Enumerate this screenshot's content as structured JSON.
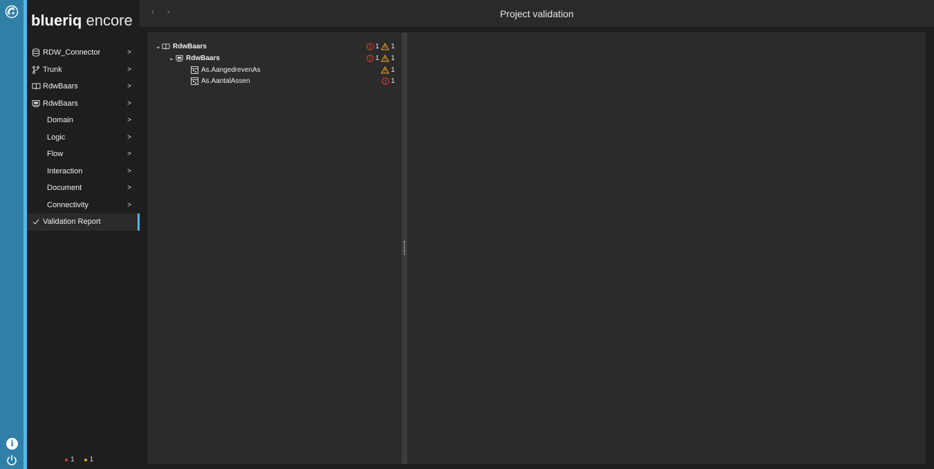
{
  "brand": {
    "name_bold": "blueriq",
    "name_light": "encore"
  },
  "header": {
    "title": "Project validation",
    "back": "‹",
    "forward": "›"
  },
  "sidebar": {
    "items": [
      {
        "label": "RDW_Connector",
        "icon": "database-icon"
      },
      {
        "label": "Trunk",
        "icon": "branch-icon"
      },
      {
        "label": "RdwBaars",
        "icon": "book-icon"
      },
      {
        "label": "RdwBaars",
        "icon": "module-icon"
      },
      {
        "label": "Domain"
      },
      {
        "label": "Logic"
      },
      {
        "label": "Flow"
      },
      {
        "label": "Interaction"
      },
      {
        "label": "Document"
      },
      {
        "label": "Connectivity"
      },
      {
        "label": "Validation Report",
        "icon": "check-icon"
      }
    ],
    "status": {
      "errors": "1",
      "warnings": "1"
    }
  },
  "tree": [
    {
      "label": "RdwBaars",
      "icon": "book-icon",
      "errors": "1",
      "warnings": "1"
    },
    {
      "label": "RdwBaars",
      "icon": "module-icon",
      "errors": "1",
      "warnings": "1"
    },
    {
      "label": "As.AangedrevenAs",
      "icon": "table-icon",
      "warnings": "1"
    },
    {
      "label": "As.AantalAssen",
      "icon": "table-icon",
      "errors": "1"
    }
  ],
  "colors": {
    "accent": "#56b6e6",
    "rail": "#2f7fa6",
    "error": "#e53935",
    "warning": "#f5a623"
  }
}
